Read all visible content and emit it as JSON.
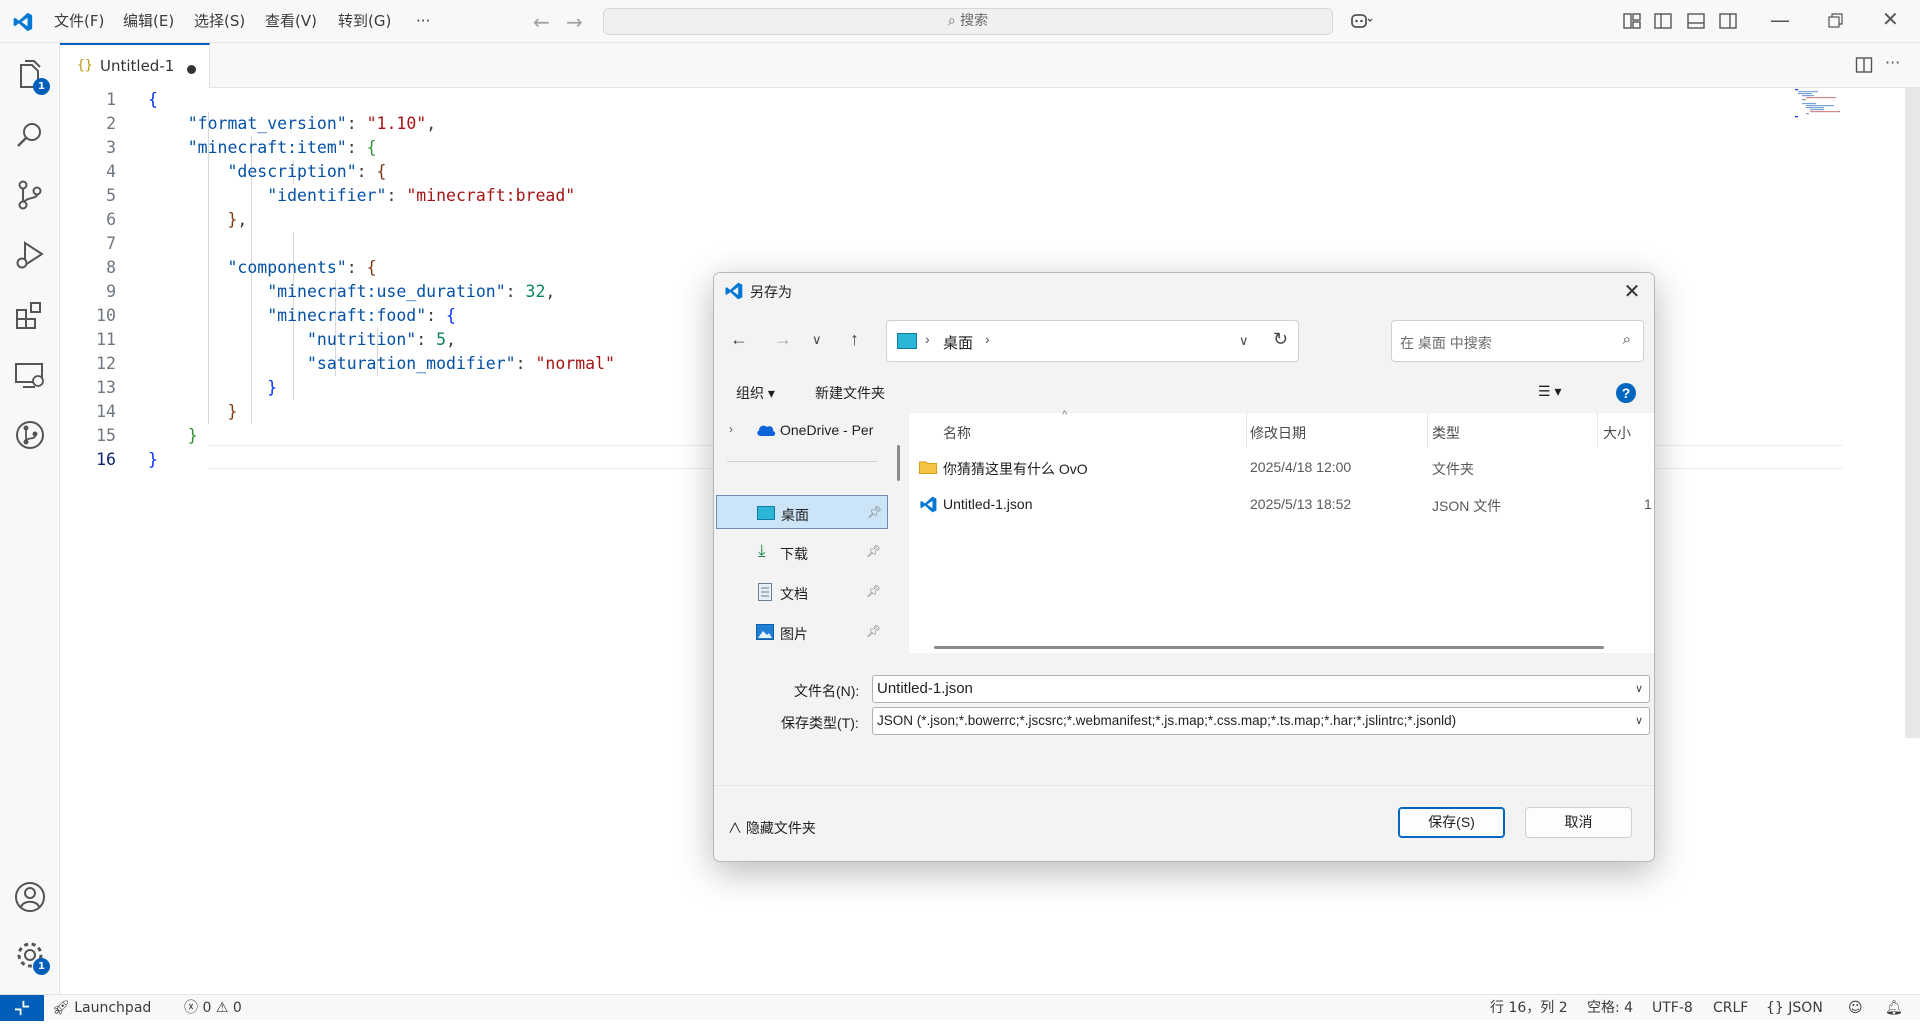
{
  "titlebar": {
    "menu": [
      "文件(F)",
      "编辑(E)",
      "选择(S)",
      "查看(V)",
      "转到(G)"
    ],
    "more": "···",
    "search_placeholder": "搜索"
  },
  "activity": {
    "explorer_badge": "1",
    "settings_badge": "1"
  },
  "tab": {
    "label": "Untitled-1",
    "icon": "{}"
  },
  "editor": {
    "current_line": 16,
    "lines": [
      "1",
      "2",
      "3",
      "4",
      "5",
      "6",
      "7",
      "8",
      "9",
      "10",
      "11",
      "12",
      "13",
      "14",
      "15",
      "16"
    ],
    "code": {
      "format_version_key": "\"format_version\"",
      "format_version_val": "\"1.10\"",
      "item_key": "\"minecraft:item\"",
      "description_key": "\"description\"",
      "identifier_key": "\"identifier\"",
      "identifier_val": "\"minecraft:bread\"",
      "components_key": "\"components\"",
      "use_duration_key": "\"minecraft:use_duration\"",
      "use_duration_val": "32",
      "food_key": "\"minecraft:food\"",
      "nutrition_key": "\"nutrition\"",
      "nutrition_val": "5",
      "saturation_key": "\"saturation_modifier\"",
      "saturation_val": "\"normal\""
    }
  },
  "statusbar": {
    "launchpad": "Launchpad",
    "errors": "0",
    "warnings": "0",
    "position": "行 16，列 2",
    "spaces": "空格: 4",
    "encoding": "UTF-8",
    "eol": "CRLF",
    "language": "JSON",
    "language_icon": "{}"
  },
  "dialog": {
    "title": "另存为",
    "breadcrumb": "桌面",
    "search_placeholder": "在 桌面 中搜索",
    "organize": "组织 ▾",
    "new_folder": "新建文件夹",
    "help": "?",
    "nav": {
      "onedrive": "OneDrive - Per",
      "desktop": "桌面",
      "downloads": "下载",
      "documents": "文档",
      "pictures": "图片"
    },
    "columns": {
      "name": "名称",
      "modified": "修改日期",
      "type": "类型",
      "size": "大小"
    },
    "files": [
      {
        "name": "你猜猜这里有什么 OvO",
        "modified": "2025/4/18 12:00",
        "type": "文件夹",
        "size": ""
      },
      {
        "name": "Untitled-1.json",
        "modified": "2025/5/13 18:52",
        "type": "JSON 文件",
        "size": "1"
      }
    ],
    "filename_label": "文件名(N):",
    "filename_value": "Untitled-1.json",
    "filetype_label": "保存类型(T):",
    "filetype_value": "JSON (*.json;*.bowerrc;*.jscsrc;*.webmanifest;*.js.map;*.css.map;*.ts.map;*.har;*.jslintrc;*.jsonld)",
    "hide_folders": "隐藏文件夹",
    "save": "保存(S)",
    "cancel": "取消"
  }
}
